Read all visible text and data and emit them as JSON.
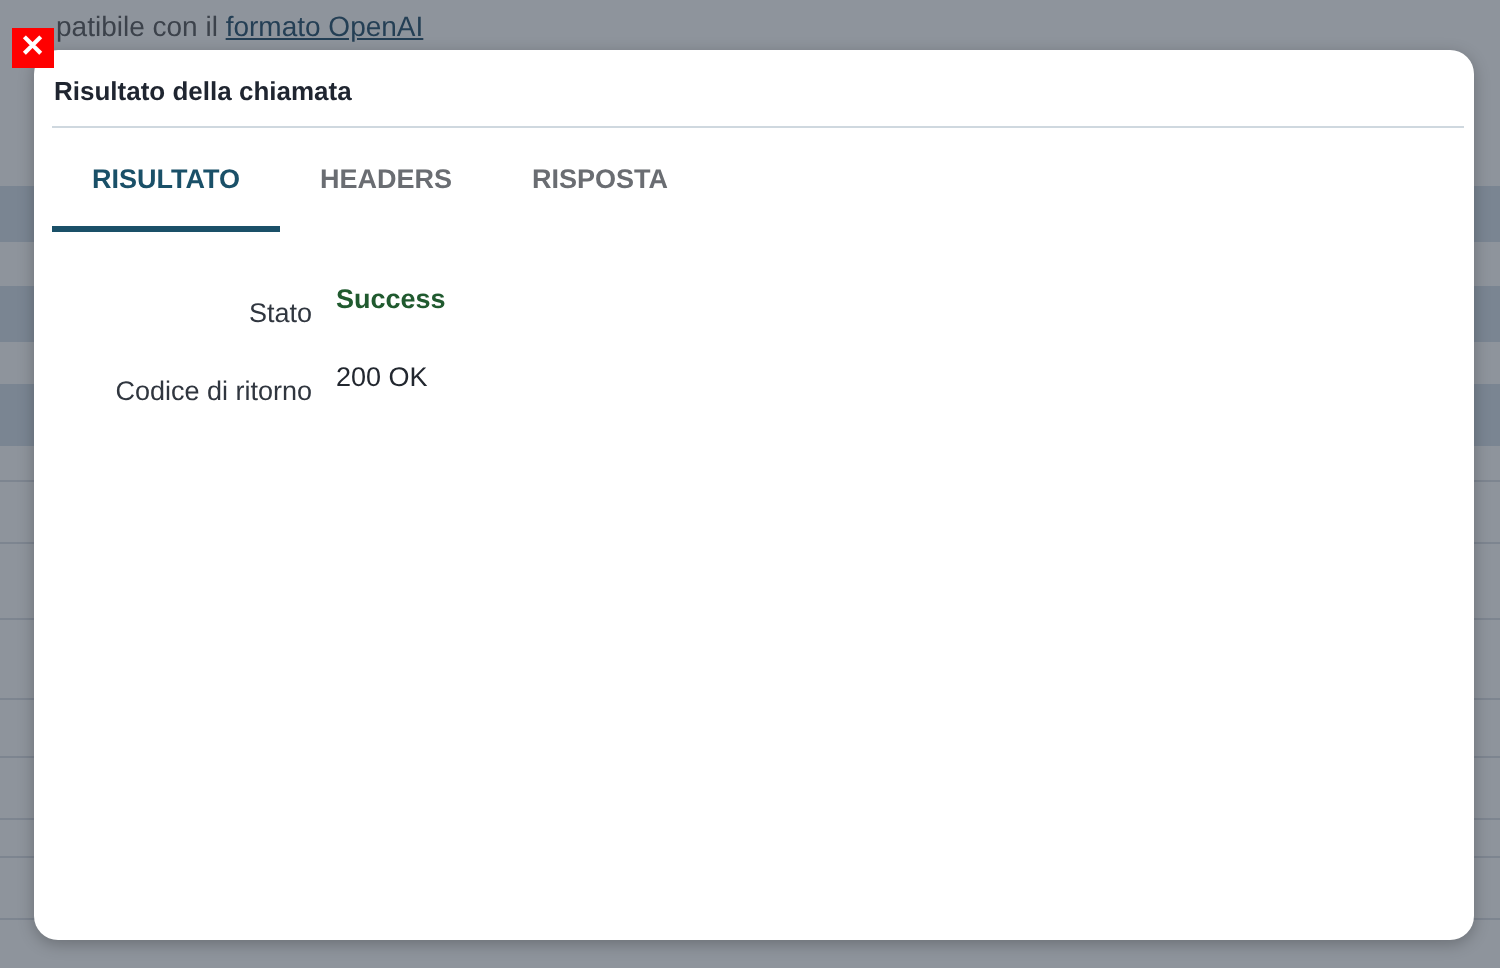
{
  "background": {
    "text": "patibile con il",
    "link": "formato OpenAI"
  },
  "close_button": {
    "symbol": "✕"
  },
  "dialog": {
    "title": "Risultato della chiamata",
    "tabs": [
      {
        "label": "RISULTATO",
        "selected": true
      },
      {
        "label": "HEADERS",
        "selected": false
      },
      {
        "label": "RISPOSTA",
        "selected": false
      }
    ],
    "fields": [
      {
        "label": "Stato",
        "value": "Success",
        "kind": "status"
      },
      {
        "label": "Codice di ritorno",
        "value": "200 OK",
        "kind": "text"
      }
    ]
  }
}
